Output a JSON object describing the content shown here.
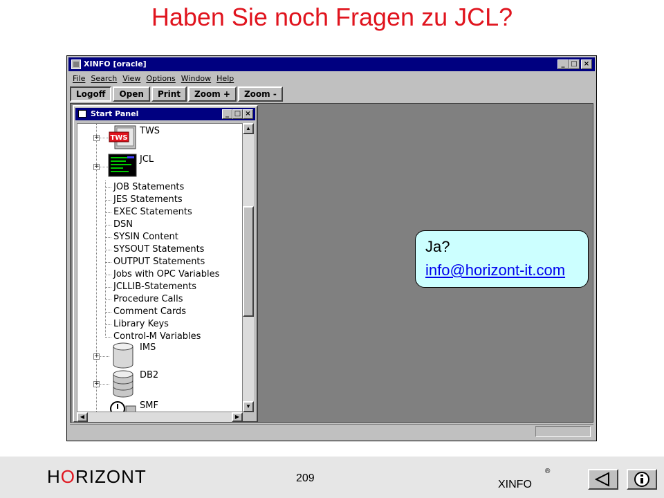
{
  "slide": {
    "title": "Haben Sie noch Fragen zu JCL?",
    "brand_pre": "H",
    "brand_o": "O",
    "brand_post": "RIZONT",
    "page_number": "209",
    "product": "XINFO",
    "registered": "®"
  },
  "window": {
    "title": "XINFO [oracle]",
    "menu": [
      "File",
      "Search",
      "View",
      "Options",
      "Window",
      "Help"
    ],
    "toolbar": [
      "Logoff",
      "Open",
      "Print",
      "Zoom +",
      "Zoom -"
    ]
  },
  "panel": {
    "title": "Start Panel",
    "tree": {
      "tws": "TWS",
      "tws_badge": "TWS",
      "jcl": "JCL",
      "jcl_children": [
        "JOB Statements",
        "JES Statements",
        "EXEC Statements",
        "DSN",
        "SYSIN Content",
        "SYSOUT Statements",
        "OUTPUT Statements",
        "Jobs with OPC Variables",
        "JCLLIB-Statements",
        "Procedure Calls",
        "Comment Cards",
        "Library Keys",
        "Control-M Variables"
      ],
      "ims": "IMS",
      "db2": "DB2",
      "smf": "SMF"
    }
  },
  "bubble": {
    "question": "Ja?",
    "email": "info@horizont-it.com"
  },
  "colors": {
    "title_red": "#e0141e",
    "titlebar_blue": "#000080",
    "bubble_fill": "#ccffff",
    "mdi_gray": "#808080"
  }
}
